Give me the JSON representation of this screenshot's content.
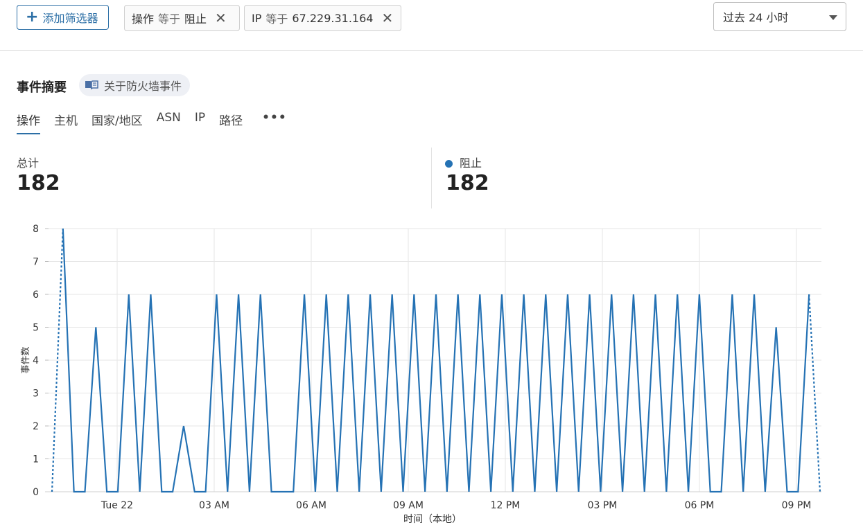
{
  "toolbar": {
    "add_filter_label": "添加筛选器",
    "filters": [
      {
        "key": "操作",
        "op": "等于",
        "value": "阻止"
      },
      {
        "key": "IP",
        "op": "等于",
        "value": "67.229.31.164"
      }
    ],
    "time_range": "过去 24 小时"
  },
  "summary": {
    "title": "事件摘要",
    "about_link": "关于防火墙事件",
    "tabs": [
      "操作",
      "主机",
      "国家/地区",
      "ASN",
      "IP",
      "路径",
      "•••"
    ],
    "active_tab": "操作",
    "total_label": "总计",
    "total_value": "182",
    "block_label": "阻止",
    "block_value": "182",
    "accent_color": "#2572b4"
  },
  "chart_data": {
    "type": "line",
    "xlabel": "时间（本地）",
    "ylabel": "事件数",
    "ylim": [
      0,
      8
    ],
    "yticks": [
      0,
      1,
      2,
      3,
      4,
      5,
      6,
      7,
      8
    ],
    "x_tick_labels": [
      "Tue 22",
      "03 AM",
      "06 AM",
      "09 AM",
      "12 PM",
      "03 PM",
      "06 PM",
      "09 PM"
    ],
    "grid": true,
    "series": [
      {
        "name": "阻止",
        "color": "#2572b4",
        "values": [
          0,
          8,
          0,
          0,
          5,
          0,
          0,
          6,
          0,
          6,
          0,
          0,
          2,
          0,
          0,
          6,
          0,
          6,
          0,
          6,
          0,
          0,
          0,
          6,
          0,
          6,
          0,
          6,
          0,
          6,
          0,
          6,
          0,
          6,
          0,
          6,
          0,
          6,
          0,
          6,
          0,
          6,
          0,
          6,
          0,
          6,
          0,
          6,
          0,
          6,
          0,
          6,
          0,
          6,
          0,
          6,
          0,
          6,
          0,
          6,
          0,
          0,
          6,
          0,
          6,
          0,
          5,
          0,
          0,
          6,
          0
        ]
      }
    ]
  }
}
